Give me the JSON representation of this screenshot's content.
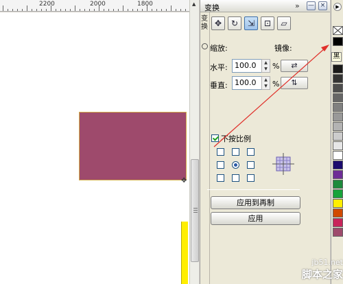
{
  "ruler": {
    "labels": [
      "2200",
      "2000",
      "1800"
    ]
  },
  "docker": {
    "title": "变换",
    "side_tab_label": "变换",
    "chevron": "»",
    "minimize_symbol": "—",
    "close_symbol": "×",
    "section_label": "缩放:",
    "mirror_label": "镜像:",
    "horizontal_label": "水平:",
    "horizontal_value": "100.0",
    "vertical_label": "垂直:",
    "vertical_value": "100.0",
    "percent": "%",
    "nonproportional_label": "不按比例",
    "apply_copy_label": "应用到再制",
    "apply_label": "应用"
  },
  "tooltip": "黑",
  "palette_colors": [
    "#000000",
    "#1a1a1a",
    "#333333",
    "#4d4d4d",
    "#666666",
    "#808080",
    "#999999",
    "#b3b3b3",
    "#cccccc",
    "#e6e6e6",
    "#ffffff",
    "#1a0a6e",
    "#6d2d96",
    "#1d8a3c",
    "#18a33a",
    "#ffee00",
    "#d14a00",
    "#c8245a",
    "#9e4a6c"
  ],
  "watermark": {
    "url": "jb51.net",
    "name": "脚本之家"
  }
}
